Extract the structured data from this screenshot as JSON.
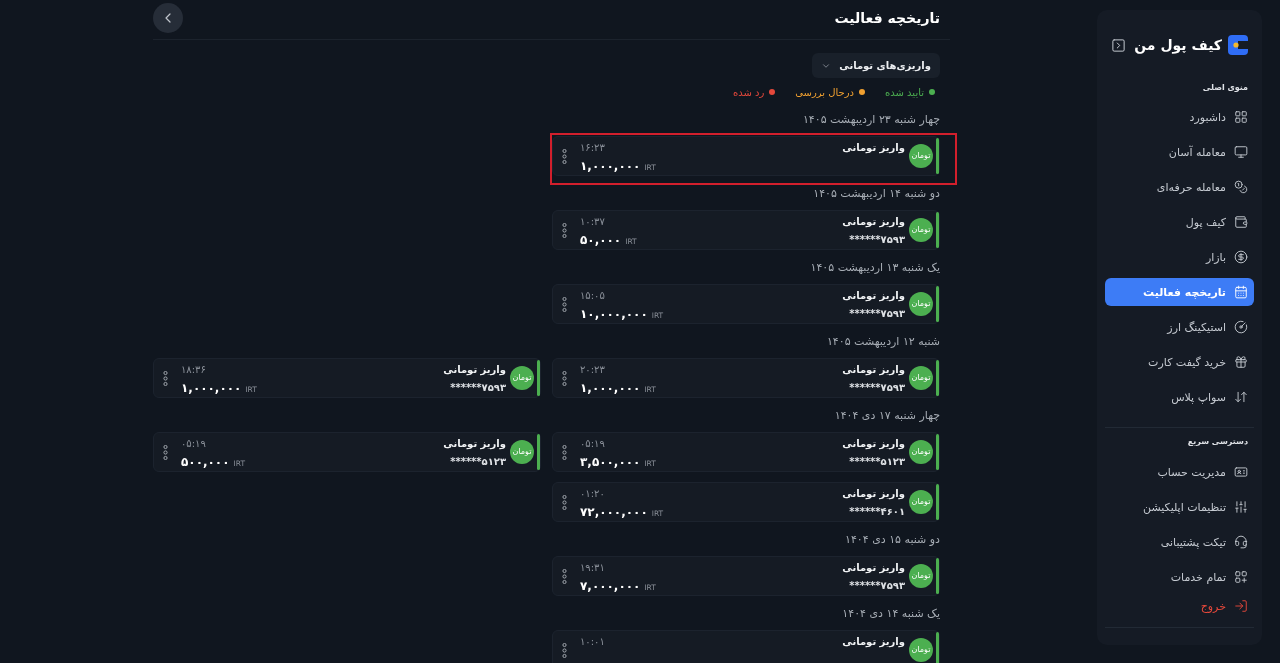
{
  "sidebar": {
    "logo": "کیف پول من",
    "main_menu": {
      "title": "منوی اصلی",
      "items": [
        {
          "label": "داشبورد",
          "selected": false
        },
        {
          "label": "معامله آسان",
          "selected": false
        },
        {
          "label": "معامله حرفه‌ای",
          "selected": false
        },
        {
          "label": "کیف پول",
          "selected": false
        },
        {
          "label": "بازار",
          "selected": false
        },
        {
          "label": "تاریخچه فعالیت",
          "selected": true
        },
        {
          "label": "استیکینگ ارز",
          "selected": false
        },
        {
          "label": "خرید گیفت کارت",
          "selected": false
        },
        {
          "label": "سواپ پلاس",
          "selected": false
        }
      ]
    },
    "quick_access": {
      "title": "دسترسی سریع",
      "items": [
        {
          "label": "مدیریت حساب",
          "selected": false,
          "kind": "link"
        },
        {
          "label": "تنظیمات اپلیکیشن",
          "selected": false,
          "kind": "link"
        },
        {
          "label": "تیکت پشتیبانی",
          "selected": false,
          "kind": "link"
        },
        {
          "label": "تمام خدمات",
          "selected": false,
          "kind": "link"
        },
        {
          "label": "خروج",
          "selected": false,
          "kind": "logout"
        }
      ]
    }
  },
  "header": {
    "title": "تاریخچه فعالیت"
  },
  "filter": {
    "value": "واریزی‌های تومانی"
  },
  "legend": [
    {
      "label": "تایید شده",
      "color": "#4caf50"
    },
    {
      "label": "درحال بررسی",
      "color": "#f0a030"
    },
    {
      "label": "رد شده",
      "color": "#e5483b"
    }
  ],
  "groups": [
    {
      "date": "چهار شنبه ۲۳ اردیبهشت ۱۴۰۵",
      "items": [
        {
          "kind": "approved",
          "title": "واریز تومانی",
          "badge": "تومان",
          "time": "۱۶:۲۳",
          "amount": "۱,۰۰۰,۰۰۰",
          "currency": "IRT",
          "highlighted": true
        }
      ]
    },
    {
      "date": "دو شنبه ۱۴ اردیبهشت ۱۴۰۵",
      "items": [
        {
          "kind": "approved",
          "title": "واریز تومانی",
          "badge": "تومان",
          "masked": "******۷۵۹۳",
          "time": "۱۰:۳۷",
          "amount": "۵۰,۰۰۰",
          "currency": "IRT",
          "highlighted": false
        }
      ]
    },
    {
      "date": "یک شنبه ۱۳ اردیبهشت ۱۴۰۵",
      "items": [
        {
          "kind": "approved",
          "title": "واریز تومانی",
          "badge": "تومان",
          "masked": "******۷۵۹۳",
          "time": "۱۵:۰۵",
          "amount": "۱۰,۰۰۰,۰۰۰",
          "currency": "IRT",
          "highlighted": false
        }
      ]
    },
    {
      "date": "شنبه ۱۲ اردیبهشت ۱۴۰۵",
      "items": [
        {
          "kind": "approved",
          "title": "واریز تومانی",
          "badge": "تومان",
          "masked": "******۷۵۹۳",
          "time": "۲۰:۲۳",
          "amount": "۱,۰۰۰,۰۰۰",
          "currency": "IRT",
          "highlighted": false
        },
        {
          "kind": "approved",
          "title": "واریز تومانی",
          "badge": "تومان",
          "masked": "******۷۵۹۳",
          "time": "۱۸:۳۶",
          "amount": "۱,۰۰۰,۰۰۰",
          "currency": "IRT",
          "highlighted": false
        }
      ]
    },
    {
      "date": "چهار شنبه ۱۷ دی ۱۴۰۴",
      "items": [
        {
          "kind": "approved",
          "title": "واریز تومانی",
          "badge": "تومان",
          "masked": "******۵۱۲۳",
          "time": "۰۵:۱۹",
          "amount": "۳,۵۰۰,۰۰۰",
          "currency": "IRT",
          "highlighted": false
        },
        {
          "kind": "approved",
          "title": "واریز تومانی",
          "badge": "تومان",
          "masked": "******۵۱۲۳",
          "time": "۰۵:۱۹",
          "amount": "۵۰۰,۰۰۰",
          "currency": "IRT",
          "highlighted": false
        },
        {
          "kind": "approved",
          "title": "واریز تومانی",
          "badge": "تومان",
          "masked": "******۴۶۰۱",
          "time": "۰۱:۲۰",
          "amount": "۷۲,۰۰۰,۰۰۰",
          "currency": "IRT",
          "highlighted": false
        }
      ]
    },
    {
      "date": "دو شنبه ۱۵ دی ۱۴۰۴",
      "items": [
        {
          "kind": "approved",
          "title": "واریز تومانی",
          "badge": "تومان",
          "masked": "******۷۵۹۳",
          "time": "۱۹:۳۱",
          "amount": "۷,۰۰۰,۰۰۰",
          "currency": "IRT",
          "highlighted": false
        }
      ]
    },
    {
      "date": "یک شنبه ۱۴ دی ۱۴۰۴",
      "items": [
        {
          "kind": "approved",
          "title": "واریز تومانی",
          "badge": "تومان",
          "time": "۱۰:۰۱",
          "highlighted": false
        }
      ]
    }
  ]
}
